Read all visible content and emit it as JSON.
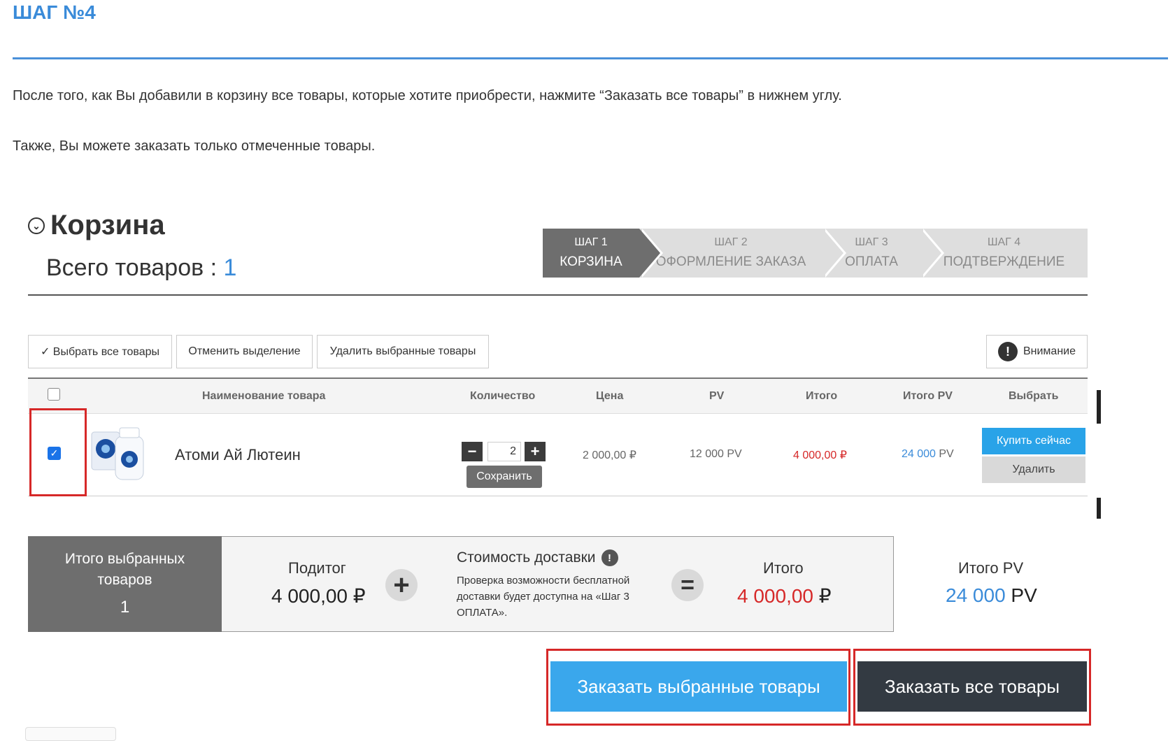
{
  "page": {
    "step_heading": "ШАГ №4",
    "paragraph1": "После того, как Вы добавили в корзину все товары, которые хотите приобрести, нажмите “Заказать все товары” в нижнем углу.",
    "paragraph2": "Также, Вы можете заказать только отмеченные товары."
  },
  "cart": {
    "title": "Корзина",
    "total_label": "Всего товаров : ",
    "total_count": "1",
    "steps": [
      {
        "num": "ШАГ 1",
        "title": "КОРЗИНА",
        "active": true
      },
      {
        "num": "ШАГ 2",
        "title": "ОФОРМЛЕНИЕ ЗАКАЗА",
        "active": false
      },
      {
        "num": "ШАГ 3",
        "title": "ОПЛАТА",
        "active": false
      },
      {
        "num": "ШАГ 4",
        "title": "ПОДТВЕРЖДЕНИЕ",
        "active": false
      }
    ],
    "toolbar": {
      "select_all": "✓ Выбрать все товары",
      "deselect": "Отменить выделение",
      "delete_selected": "Удалить выбранные товары",
      "attention": "Внимание"
    },
    "columns": [
      "Наименование товара",
      "Количество",
      "Цена",
      "PV",
      "Итого",
      "Итого PV",
      "Выбрать"
    ],
    "item": {
      "name": "Атоми Ай Лютеин",
      "quantity": "2",
      "save": "Сохранить",
      "price": "2 000,00 ₽",
      "pv": "12 000 PV",
      "total": "4 000,00 ₽",
      "total_pv_num": "24 000",
      "total_pv_unit": " PV",
      "buy_now": "Купить сейчас",
      "delete": "Удалить",
      "checked": true
    },
    "summary": {
      "selected_label": "Итого выбранных товаров",
      "selected_count": "1",
      "subtotal_label": "Подитог",
      "subtotal_value": "4 000,00 ₽",
      "delivery_label": "Стоимость доставки",
      "delivery_note": "Проверка возможности бесплатной доставки будет доступна на «Шаг 3 ОПЛАТА».",
      "total_label": "Итого",
      "total_value": "4 000,00",
      "total_currency": " ₽",
      "total_pv_label": "Итого PV",
      "total_pv_value": "24 000",
      "total_pv_unit": " PV"
    },
    "order_selected": "Заказать выбранные товары",
    "order_all": "Заказать все товары"
  },
  "colors": {
    "accent_blue": "#3a8bd9",
    "highlight_red": "#d62828",
    "dark_button": "#333a42",
    "step_active": "#6e6e6e"
  }
}
